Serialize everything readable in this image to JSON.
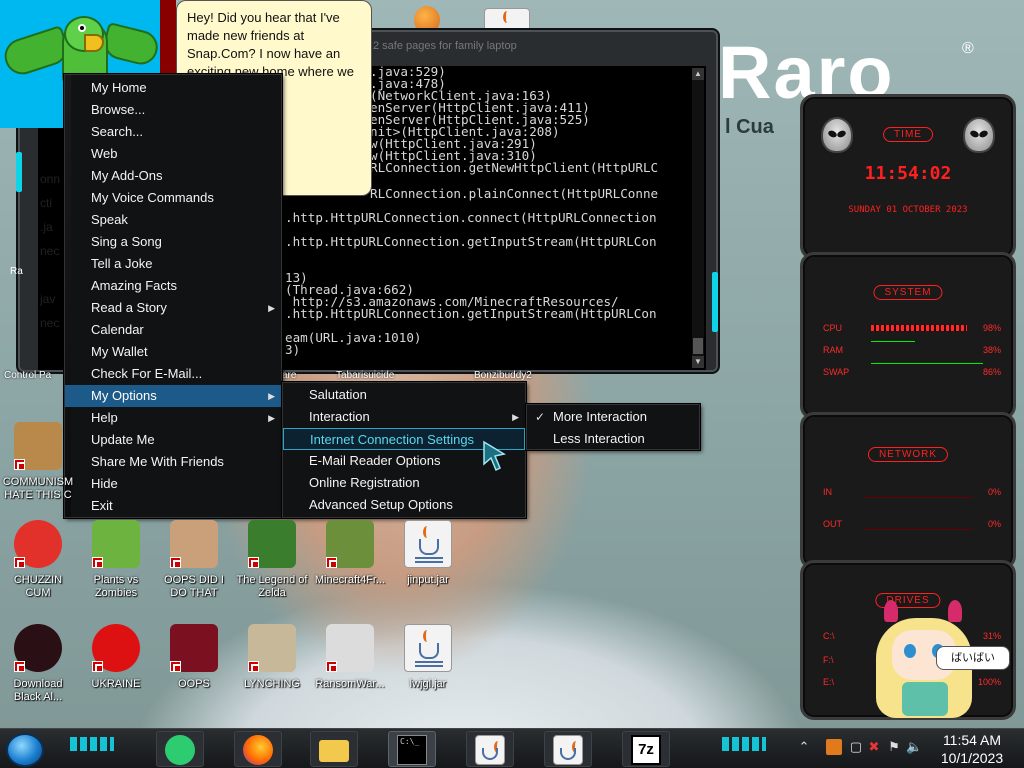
{
  "agent": {
    "speech": "Hey! Did you hear that I've made new friends at Snap.Com? I now have an exciting new home where we can hang out!"
  },
  "console": {
    "title": "2 safe pages for family laptop",
    "lines": [
      ".java:529)",
      ".java:478)",
      "(NetworkClient.java:163)",
      "enServer(HttpClient.java:411)",
      "enServer(HttpClient.java:525)",
      "nit>(HttpClient.java:208)",
      "w(HttpClient.java:291)",
      "w(HttpClient.java:310)",
      "RLConnection.getNewHttpClient(HttpURLC",
      "RLConnection.plainConnect(HttpURLConne",
      ".http.HttpURLConnection.connect(HttpURLConnection",
      ".http.HttpURLConnection.getInputStream(HttpURLCon",
      "13)",
      "(Thread.java:662)",
      " http://s3.amazonaws.com/MinecraftResources/",
      ".http.HttpURLConnection.getInputStream(HttpURLCon",
      "eam(URL.java:1010)",
      "3)"
    ]
  },
  "background_fragments": {
    "onn": "onn",
    "cti": "cti",
    "ja": ".ja",
    "nec1": "nec",
    "jav": "jav",
    "nec2": "nec",
    "r": "Ra",
    "control": "Control Pa",
    "ware": "are",
    "tabaris": "Tabarisuicide",
    "bonzi": "Bonzibuddy2",
    "aro": "Raro",
    "cua": "l Cua"
  },
  "menu_main": {
    "items": [
      {
        "label": "My Home"
      },
      {
        "label": "Browse..."
      },
      {
        "label": "Search..."
      },
      {
        "label": "Web"
      },
      {
        "label": "My Add-Ons"
      },
      {
        "label": "My Voice Commands"
      },
      {
        "label": "Speak"
      },
      {
        "label": "Sing a Song"
      },
      {
        "label": "Tell a Joke"
      },
      {
        "label": "Amazing Facts"
      },
      {
        "label": "Read a Story"
      },
      {
        "label": "Calendar"
      },
      {
        "label": "My Wallet"
      },
      {
        "label": "Check For E-Mail..."
      },
      {
        "label": "My Options"
      },
      {
        "label": "Help"
      },
      {
        "label": "Update Me"
      },
      {
        "label": "Share Me With Friends"
      },
      {
        "label": "Hide"
      },
      {
        "label": "Exit"
      }
    ]
  },
  "menu_options": {
    "items": [
      {
        "label": "Salutation"
      },
      {
        "label": "Interaction"
      },
      {
        "label": "Internet Connection Settings"
      },
      {
        "label": "E-Mail Reader Options"
      },
      {
        "label": "Online Registration"
      },
      {
        "label": "Advanced Setup Options"
      }
    ]
  },
  "menu_interaction": {
    "items": [
      {
        "label": "More Interaction",
        "checked": true
      },
      {
        "label": "Less Interaction",
        "checked": false
      }
    ]
  },
  "desktop_icons": [
    {
      "label": "COMMUNISM HATE THIS C",
      "icon": "money-bag-icon"
    },
    {
      "label": "CHUZZIN CUM",
      "icon": "chuzzle-icon"
    },
    {
      "label": "Plants vs Zombies",
      "icon": "plants-vs-zombies-icon"
    },
    {
      "label": "OOPS DID I DO THAT",
      "icon": "portrait-icon"
    },
    {
      "label": "The Legend of Zelda",
      "icon": "zelda-icon"
    },
    {
      "label": "Minecraft4Fr...",
      "icon": "minecraft-icon"
    },
    {
      "label": "jinput.jar",
      "icon": "java-icon"
    },
    {
      "label": "Download Black Al...",
      "icon": "black-orb-icon"
    },
    {
      "label": "UKRAINE",
      "icon": "radiation-icon"
    },
    {
      "label": "OOPS",
      "icon": "oops-icon"
    },
    {
      "label": "LYNCHING",
      "icon": "rope-icon"
    },
    {
      "label": "RansomWar...",
      "icon": "skull-icon"
    },
    {
      "label": "lwjgl.jar",
      "icon": "java-icon"
    }
  ],
  "gadgets": {
    "time": {
      "title": "TIME",
      "clock": "11:54:02",
      "date": "SUNDAY 01 OCTOBER 2023"
    },
    "system": {
      "title": "SYSTEM",
      "rows": [
        {
          "label": "CPU",
          "value": "98%",
          "level": 0.98
        },
        {
          "label": "RAM",
          "value": "38%",
          "level": 0.38
        },
        {
          "label": "SWAP",
          "value": "86%",
          "level": 0.86
        }
      ]
    },
    "network": {
      "title": "NETWORK",
      "rows": [
        {
          "label": "IN",
          "value": "0%"
        },
        {
          "label": "OUT",
          "value": "0%"
        }
      ]
    },
    "drives": {
      "title": "DRIVES",
      "rows": [
        {
          "label": "C:\\",
          "value": "31%"
        },
        {
          "label": "F:\\",
          "value": "—"
        },
        {
          "label": "E:\\",
          "value": "100%"
        }
      ]
    }
  },
  "character_speech": "ばいばい",
  "taskbar": {
    "time": "11:54 AM",
    "date": "10/1/2023",
    "apps": [
      {
        "name": "green-app-icon"
      },
      {
        "name": "firefox-icon"
      },
      {
        "name": "file-explorer-icon"
      },
      {
        "name": "command-prompt-icon"
      },
      {
        "name": "java-icon"
      },
      {
        "name": "java-icon"
      },
      {
        "name": "7zip-icon"
      }
    ],
    "seven_zip_label": "7z",
    "cmd_label": "C:\\_"
  },
  "colors": {
    "menu_highlight": "#1c5a8a",
    "accent_cyan": "#13d6ea",
    "gadget_red": "#ff2020"
  }
}
